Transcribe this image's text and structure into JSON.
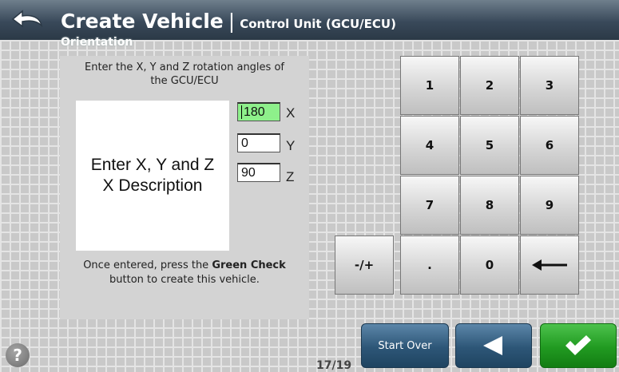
{
  "header": {
    "title": "Create Vehicle",
    "separator": "|",
    "subtitle": "Control Unit (GCU/ECU)",
    "section": "Orientation"
  },
  "instructions": {
    "top_line1": "Enter the X, Y and Z rotation angles of",
    "top_line2": "the GCU/ECU",
    "description_line1": "Enter X, Y and Z",
    "description_line2": "X Description",
    "footer_pre": "Once entered, press the ",
    "footer_bold": "Green Check",
    "footer_line2": "button to create this vehicle."
  },
  "inputs": [
    {
      "value": "180",
      "axis": "X"
    },
    {
      "value": "0",
      "axis": "Y"
    },
    {
      "value": "90",
      "axis": "Z"
    }
  ],
  "keypad": {
    "k1": "1",
    "k2": "2",
    "k3": "3",
    "k4": "4",
    "k5": "5",
    "k6": "6",
    "k7": "7",
    "k8": "8",
    "k9": "9",
    "dot": ".",
    "k0": "0",
    "sign": "-/+"
  },
  "buttons": {
    "start_over": "Start Over"
  },
  "page": {
    "indicator": "17/19"
  },
  "help": "?",
  "colors": {
    "header": "#39495a",
    "active_input": "#8ef08b",
    "nav_blue": "#2d5677",
    "confirm_green": "#219a21"
  }
}
